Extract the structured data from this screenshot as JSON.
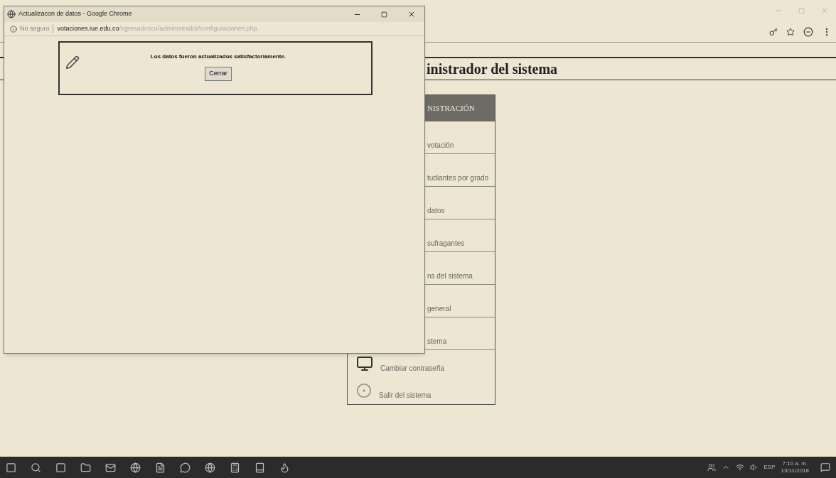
{
  "main_page": {
    "heading": "inistrador del sistema",
    "menu": {
      "header": "NISTRACIÓN",
      "items": [
        {
          "kind": "covered",
          "label": "votación"
        },
        {
          "kind": "covered",
          "label": "tudiantes por grado"
        },
        {
          "kind": "covered",
          "label": "datos"
        },
        {
          "kind": "covered",
          "label": "sufragantes"
        },
        {
          "kind": "covered",
          "label": "ns del sistema"
        },
        {
          "kind": "covered",
          "label": "general"
        },
        {
          "kind": "covered",
          "label": "stema"
        },
        {
          "kind": "monitor",
          "label": "Cambiar contraseña"
        },
        {
          "kind": "exit",
          "label": "Salir del sistema"
        }
      ]
    }
  },
  "popup": {
    "title": "Actualizacon de datos - Google Chrome",
    "security": "No seguro",
    "url_host": "votaciones.iue.edu.co",
    "url_path": "/egresadosco/administrador/configuraciones.php",
    "message": "Los datos fueron actualizados satisfactoriamente.",
    "button": "Cerrar"
  },
  "taskbar": {
    "language": "ESP",
    "time": "7:10 a. m.",
    "date": "13/11/2018"
  }
}
